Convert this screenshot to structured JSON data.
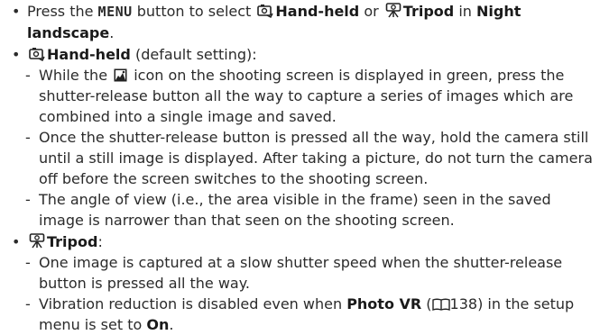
{
  "bullet1": {
    "t1": "Press the ",
    "menu": "MENU",
    "t2": " button to select ",
    "handheld": "Hand-held",
    "t3": " or ",
    "tripod": "Tripod",
    "t4": " in ",
    "nightlandscape": "Night landscape",
    "t5": "."
  },
  "bullet2": {
    "handheld": "Hand-held",
    "rest": " (default setting):",
    "items": [
      {
        "t1": "While the ",
        "t2": " icon on the shooting screen is displayed in green, press the shutter-release button all the way to capture a series of images which are combined into a single image and saved."
      },
      {
        "text": "Once the shutter-release button is pressed all the way, hold the camera still until a still image is displayed. After taking a picture, do not turn the camera off before the screen switches to the shooting screen."
      },
      {
        "text": "The angle of view (i.e., the area visible in the frame) seen in the saved image is narrower than that seen on the shooting screen."
      }
    ]
  },
  "bullet3": {
    "tripod": "Tripod",
    "rest": ":",
    "items": [
      {
        "text": "One image is captured at a slow shutter speed when the shutter-release button is pressed all the way."
      },
      {
        "t1": "Vibration reduction is disabled even when ",
        "photovr": "Photo VR",
        "t2": " (",
        "page": "138",
        "t3": ") in the setup menu is set to ",
        "on": "On",
        "t4": "."
      }
    ]
  }
}
